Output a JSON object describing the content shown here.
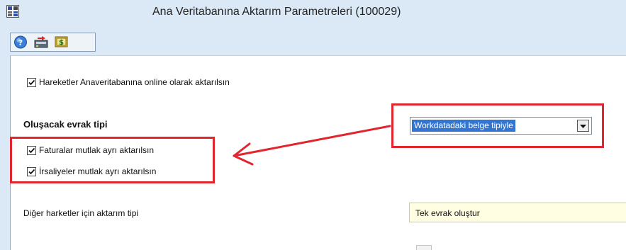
{
  "window": {
    "title": "Ana Veritabanına Aktarım Parametreleri (100029)",
    "background": "#dbe9f7"
  },
  "toolbar": {
    "buttons": [
      {
        "icon": "help-icon"
      },
      {
        "icon": "transfer-icon"
      },
      {
        "icon": "money-icon"
      }
    ]
  },
  "form": {
    "online_transfer_label": "Hareketler Anaveritabanına online olarak aktarılsın",
    "online_transfer_checked": true,
    "document_type_heading": "Oluşacak evrak tipi",
    "document_type_value": "Workdatadaki belge tipiyle",
    "invoices_separate_label": "Faturalar mutlak ayrı aktarılsın",
    "invoices_separate_checked": true,
    "waybills_separate_label": "İrsaliyeler mutlak ayrı aktarılsın",
    "waybills_separate_checked": true,
    "other_movements_label": "Diğer harketler için aktarım tipi",
    "other_movements_value": "Tek evrak oluştur"
  },
  "annotation": {
    "highlight_color": "#e0262f"
  }
}
